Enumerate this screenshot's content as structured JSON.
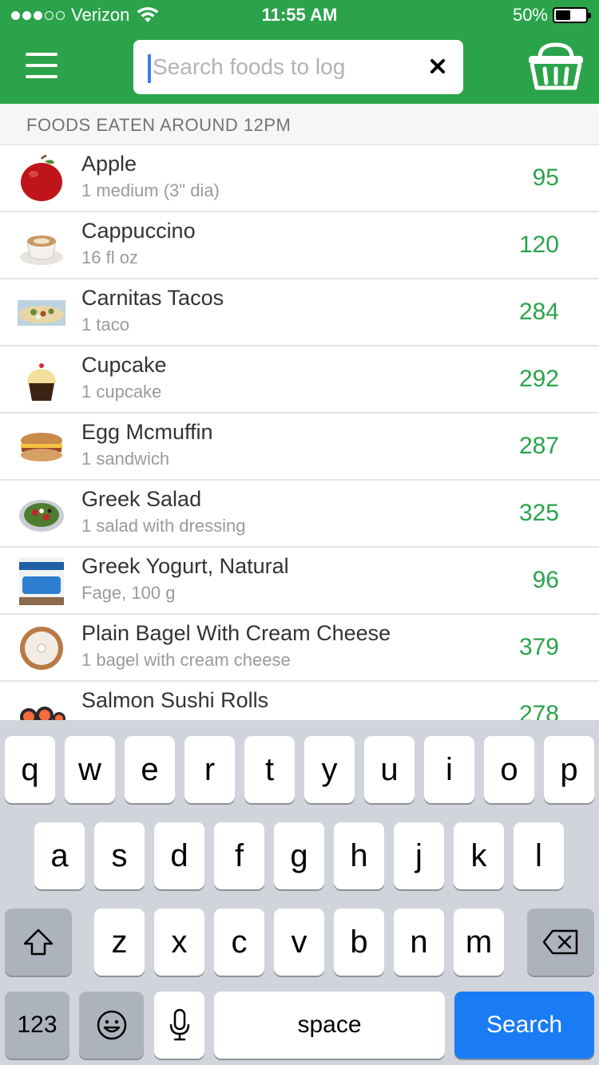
{
  "status_bar": {
    "carrier": "Verizon",
    "time": "11:55 AM",
    "battery": "50%",
    "battery_level": 0.5,
    "signal_bars_filled": 3,
    "signal_bars_total": 5
  },
  "header": {
    "background_color": "#2ba34b",
    "menu_icon": "hamburger-menu-icon",
    "basket_icon": "basket-icon",
    "clear_icon": "close-icon"
  },
  "search": {
    "placeholder": "Search foods to log",
    "value": ""
  },
  "section": {
    "title": "FOODS EATEN AROUND 12PM"
  },
  "foods": [
    {
      "name": "Apple",
      "serving": "1 medium (3\" dia)",
      "calories": "95",
      "image": "apple"
    },
    {
      "name": "Cappuccino",
      "serving": "16 fl oz",
      "calories": "120",
      "image": "cappuccino"
    },
    {
      "name": "Carnitas Tacos",
      "serving": "1 taco",
      "calories": "284",
      "image": "tacos"
    },
    {
      "name": "Cupcake",
      "serving": "1 cupcake",
      "calories": "292",
      "image": "cupcake"
    },
    {
      "name": "Egg Mcmuffin",
      "serving": "1 sandwich",
      "calories": "287",
      "image": "sandwich"
    },
    {
      "name": "Greek Salad",
      "serving": "1 salad with dressing",
      "calories": "325",
      "image": "salad"
    },
    {
      "name": "Greek Yogurt, Natural",
      "serving": "Fage, 100 g",
      "calories": "96",
      "image": "yogurt"
    },
    {
      "name": "Plain Bagel With Cream Cheese",
      "serving": "1 bagel with cream cheese",
      "calories": "379",
      "image": "bagel"
    },
    {
      "name": "Salmon Sushi Rolls",
      "serving": "",
      "calories": "278",
      "image": "sushi"
    }
  ],
  "keyboard": {
    "row1": [
      "q",
      "w",
      "e",
      "r",
      "t",
      "y",
      "u",
      "i",
      "o",
      "p"
    ],
    "row2": [
      "a",
      "s",
      "d",
      "f",
      "g",
      "h",
      "j",
      "k",
      "l"
    ],
    "row3": [
      "z",
      "x",
      "c",
      "v",
      "b",
      "n",
      "m"
    ],
    "numbers_label": "123",
    "space_label": "space",
    "search_label": "Search"
  }
}
